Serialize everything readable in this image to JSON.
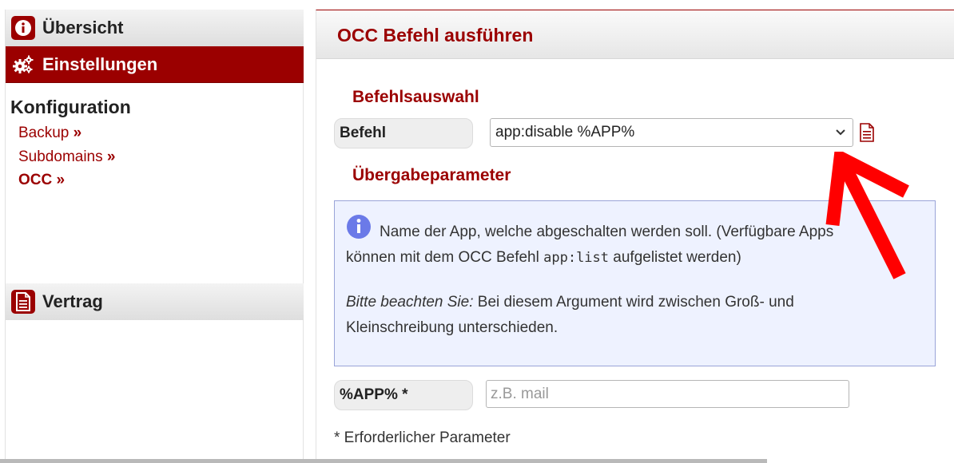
{
  "sidebar": {
    "uebersicht": "Übersicht",
    "einstellungen": "Einstellungen",
    "section_title": "Konfiguration",
    "links": {
      "backup": "Backup",
      "subdomains": "Subdomains",
      "occ": "OCC"
    },
    "raquo": "»",
    "vertrag": "Vertrag"
  },
  "main": {
    "title": "OCC Befehl ausführen",
    "befehlsauswahl": "Befehlsauswahl",
    "befehl_label": "Befehl",
    "befehl_value": "app:disable %APP%",
    "uebergabeparameter": "Übergabeparameter",
    "info": {
      "line1": "Name der App, welche abgeschalten werden soll. (Verfügbare Apps",
      "line2_before": "können mit dem OCC Befehl ",
      "line2_code": "app:list",
      "line2_after": " aufgelistet werden)",
      "line3_em": "Bitte beachten Sie:",
      "line3_rest": " Bei diesem Argument wird zwischen Groß- und",
      "line4": "Kleinschreibung unterschieden."
    },
    "param_label": "%APP% *",
    "param_placeholder": "z.B. mail",
    "footnote": "* Erforderlicher Parameter"
  },
  "colors": {
    "brand": "#9b0000",
    "annotation_arrow": "#ff0000",
    "info_bg": "#eef2ff",
    "info_border": "#9aa4d8"
  },
  "icons": {
    "uebersicht": "info-icon",
    "einstellungen": "gears-icon",
    "vertrag": "document-icon",
    "select": "chevron-down-icon",
    "help": "document-icon",
    "info": "info-circle-icon"
  }
}
